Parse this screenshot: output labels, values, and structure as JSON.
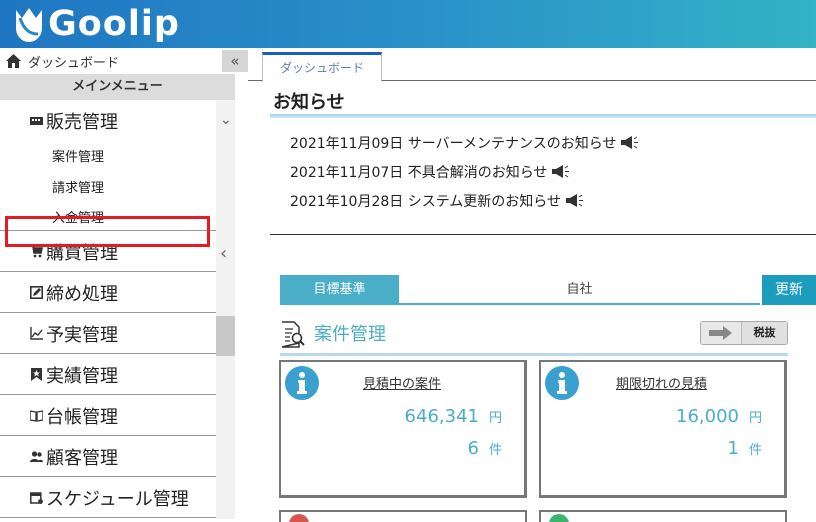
{
  "header": {
    "logo_text": "Goolip"
  },
  "sidebar": {
    "home_label": "ダッシュボード",
    "collapse_icon": "«",
    "main_menu_label": "メインメニュー",
    "items": [
      {
        "label": "販売管理",
        "icon": "register-icon",
        "expanded": true,
        "subitems": [
          "案件管理",
          "請求管理",
          "入金管理"
        ]
      },
      {
        "label": "購買管理",
        "icon": "cart-icon"
      },
      {
        "label": "締め処理",
        "icon": "edit-icon"
      },
      {
        "label": "予実管理",
        "icon": "chart-icon"
      },
      {
        "label": "実績管理",
        "icon": "bookmark-icon"
      },
      {
        "label": "台帳管理",
        "icon": "book-icon"
      },
      {
        "label": "顧客管理",
        "icon": "users-icon"
      },
      {
        "label": "スケジュール管理",
        "icon": "calendar-icon"
      }
    ],
    "chevron_down": "⌄",
    "chevron_left": "‹"
  },
  "main": {
    "tab_label": "ダッシュボード",
    "notice_title": "お知らせ",
    "notices": [
      "2021年11月09日 サーバーメンテナンスのお知らせ",
      "2021年11月07日 不具合解消のお知らせ",
      "2021年10月28日 システム更新のお知らせ"
    ],
    "segment": {
      "active": "目標基準",
      "other": "自社"
    },
    "update_label": "更新",
    "section_title": "案件管理",
    "tax_label": "税抜",
    "cards": [
      {
        "title": "見積中の案件",
        "amount": "646,341",
        "amount_unit": "円",
        "count": "6",
        "count_unit": "件"
      },
      {
        "title": "期限切れの見積",
        "amount": "16,000",
        "amount_unit": "円",
        "count": "1",
        "count_unit": "件"
      }
    ],
    "colors": {
      "accent": "#4aaec9",
      "update": "#1c9cbf",
      "highlight": "#e31b23",
      "tab_top": "#1a5fc0"
    }
  }
}
